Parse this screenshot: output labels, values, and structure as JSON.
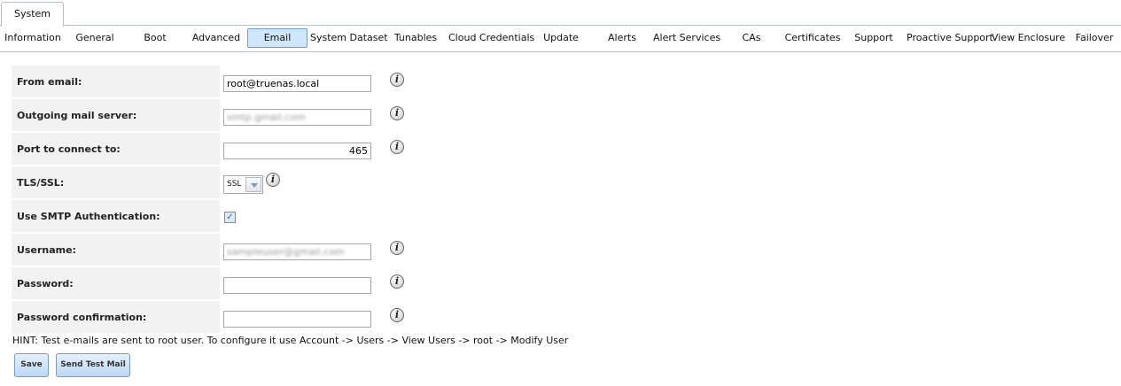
{
  "outer_tab": {
    "label": "System"
  },
  "subtabs": [
    {
      "label": "Information"
    },
    {
      "label": "General"
    },
    {
      "label": "Boot"
    },
    {
      "label": "Advanced"
    },
    {
      "label": "Email"
    },
    {
      "label": "System Dataset"
    },
    {
      "label": "Tunables"
    },
    {
      "label": "Cloud Credentials"
    },
    {
      "label": "Update"
    },
    {
      "label": "Alerts"
    },
    {
      "label": "Alert Services"
    },
    {
      "label": "CAs"
    },
    {
      "label": "Certificates"
    },
    {
      "label": "Support"
    },
    {
      "label": "Proactive Support"
    },
    {
      "label": "View Enclosure"
    },
    {
      "label": "Failover"
    }
  ],
  "active_subtab": "Email",
  "form": {
    "from_email": {
      "label": "From email:",
      "value": "root@truenas.local"
    },
    "mail_server": {
      "label": "Outgoing mail server:",
      "value": "smtp.gmail.com"
    },
    "port": {
      "label": "Port to connect to:",
      "value": "465"
    },
    "tls": {
      "label": "TLS/SSL:",
      "value": "SSL"
    },
    "smtp_auth": {
      "label": "Use SMTP Authentication:",
      "checked": true
    },
    "username": {
      "label": "Username:",
      "value": "sampleuser@gmail.com"
    },
    "password": {
      "label": "Password:",
      "value": ""
    },
    "password_confirm": {
      "label": "Password confirmation:",
      "value": ""
    }
  },
  "hint": "HINT: Test e-mails are sent to root user. To configure it use Account -> Users -> View Users -> root -> Modify User",
  "buttons": {
    "save": "Save",
    "send_test": "Send Test Mail"
  },
  "icons": {
    "info": "info-icon",
    "check": "checkmark-icon",
    "dropdown": "chevron-down-icon"
  },
  "colors": {
    "active_tab_bg": "#cfe5fa",
    "button_bg": "#bcd8f4",
    "label_bg": "#f2f2f2"
  }
}
